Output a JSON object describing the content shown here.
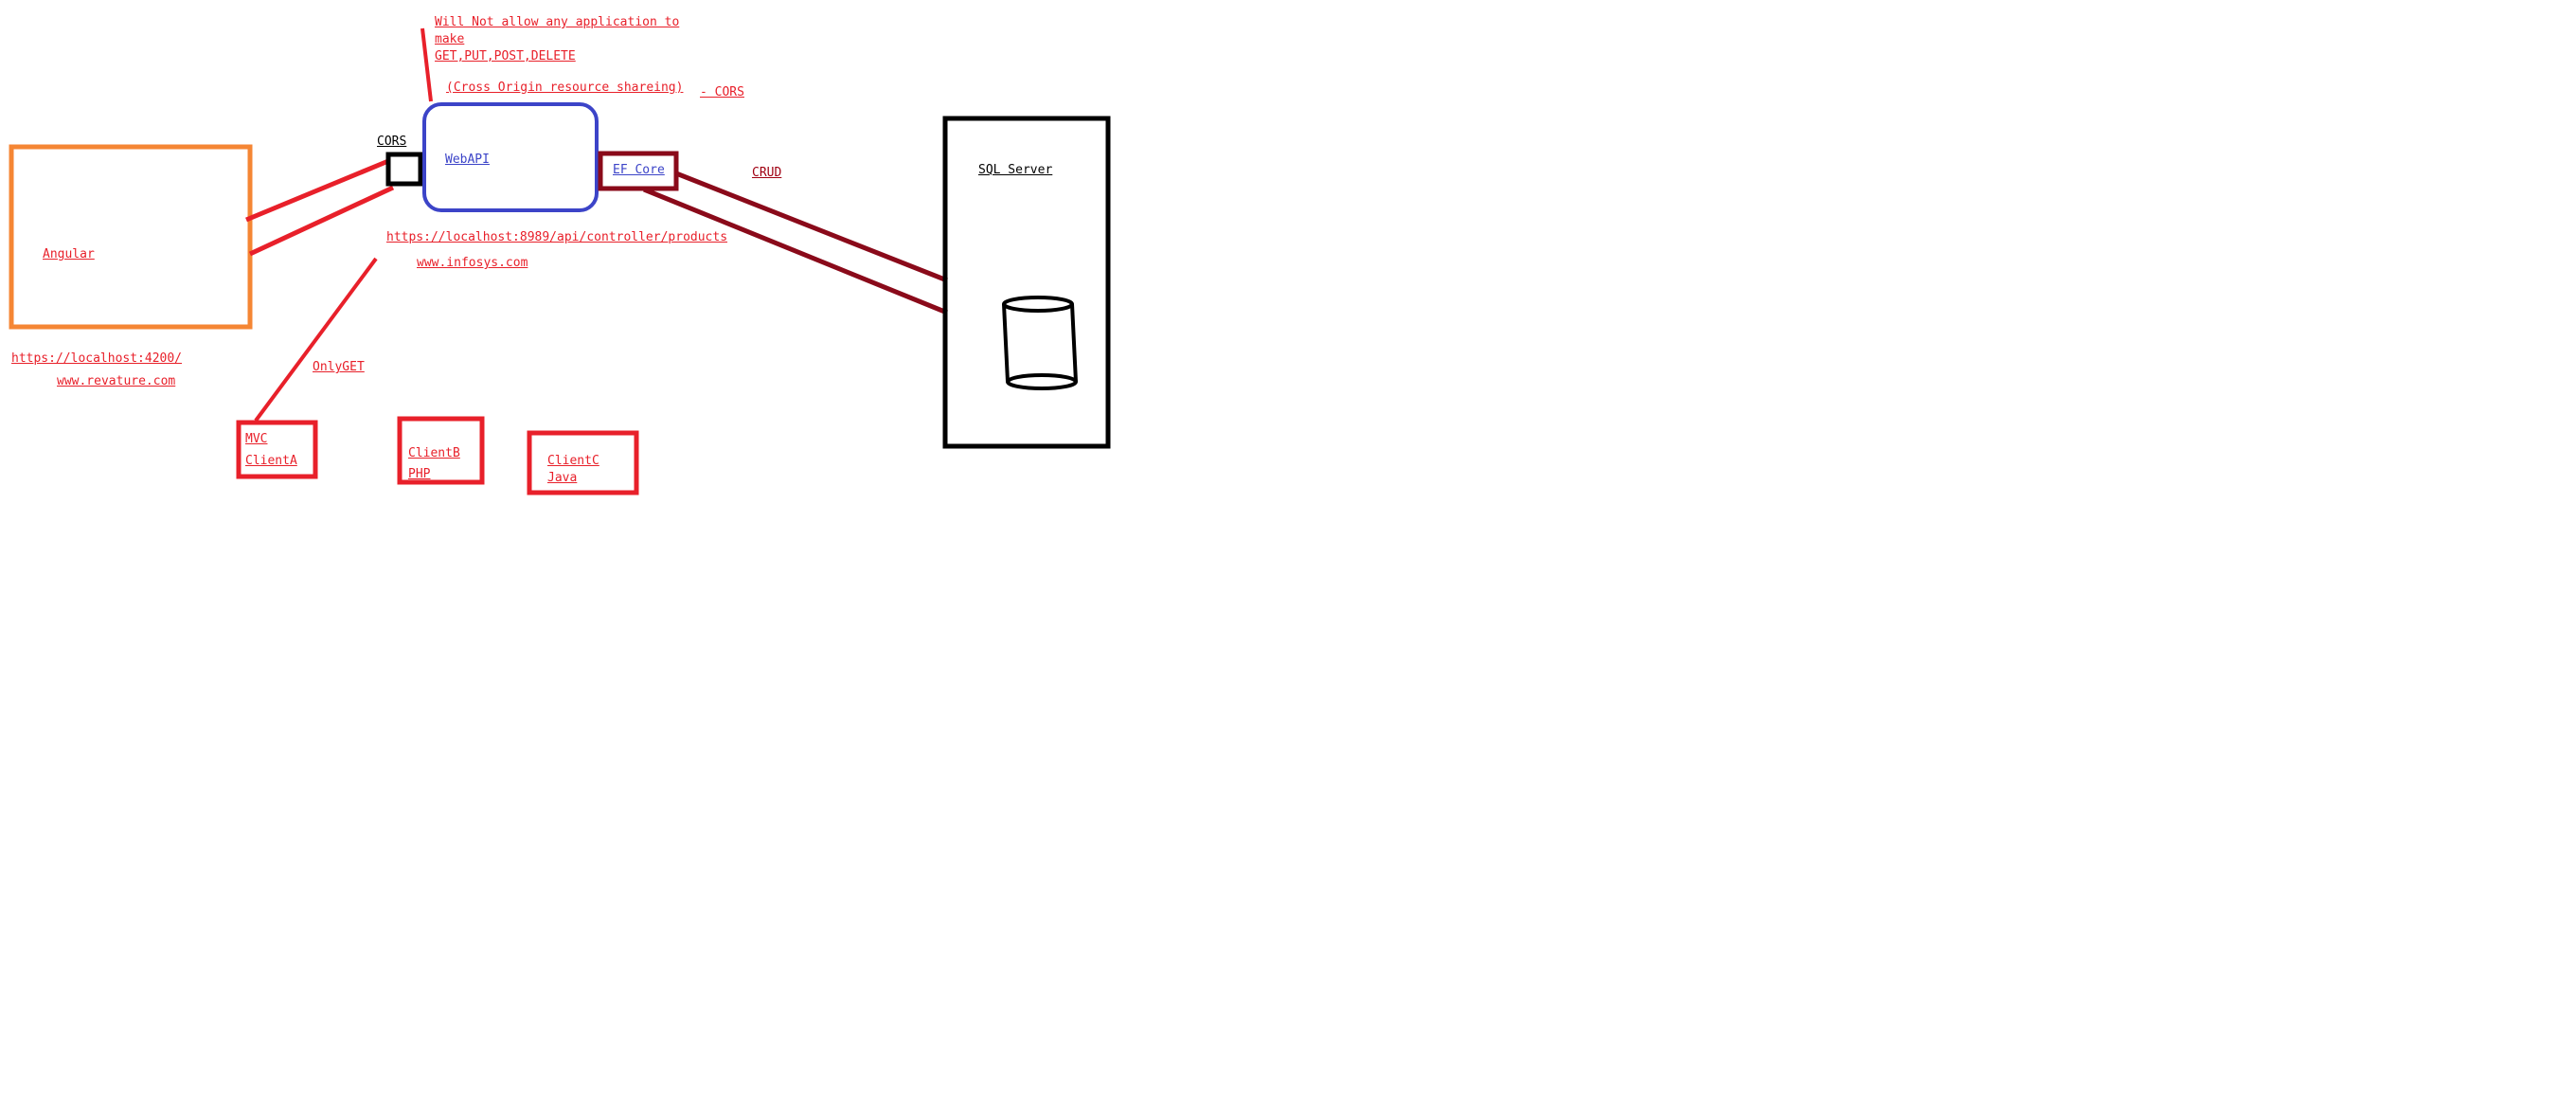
{
  "labels": {
    "note_line1": "Will Not allow any application to",
    "note_line2": "make",
    "note_line3": "GET,PUT,POST,DELETE",
    "cross_origin": "(Cross Origin resource shareing)",
    "cors_suffix": "- CORS",
    "cors_box_label": "CORS",
    "webapi": "WebAPI",
    "ef_core": "EF Core",
    "crud": "CRUD",
    "sql_server": "SQL Server",
    "angular": "Angular",
    "api_url": "https://localhost:8989/api/controller/products",
    "infosys": "www.infosys.com",
    "angular_url": "https://localhost:4200/",
    "revature": "www.revature.com",
    "onlyget": "OnlyGET",
    "client_a_line1": "MVC",
    "client_a_line2": "ClientA",
    "client_b_line1": "ClientB",
    "client_b_line2": "PHP",
    "client_c_line1": "ClientC",
    "client_c_line2": "Java"
  },
  "colors": {
    "red": "#e8202a",
    "orange": "#f58634",
    "blue": "#3c44c8",
    "maroon": "#8a0a1a",
    "black": "#000000"
  }
}
